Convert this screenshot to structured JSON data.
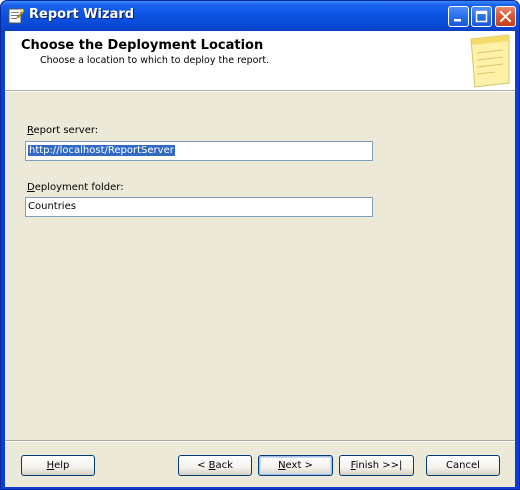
{
  "window": {
    "title": "Report Wizard",
    "title_icon": "wizard-icon"
  },
  "titlebar_buttons": {
    "minimize_icon": "minimize-icon",
    "maximize_icon": "maximize-icon",
    "close_icon": "close-icon"
  },
  "header": {
    "title": "Choose the Deployment Location",
    "subtitle": "Choose a location to which to deploy the report.",
    "icon": "notepad-icon"
  },
  "form": {
    "report_server": {
      "label_mnemonic": "R",
      "label_rest": "eport server:",
      "value": "http://localhost/ReportServer"
    },
    "deployment_folder": {
      "label_mnemonic": "D",
      "label_rest": "eployment folder:",
      "value": "Countries"
    }
  },
  "buttons": {
    "help": {
      "mnemonic": "H",
      "rest": "elp"
    },
    "back": {
      "pre": "< ",
      "mnemonic": "B",
      "rest": "ack"
    },
    "next": {
      "mnemonic": "N",
      "rest": "ext >"
    },
    "finish": {
      "mnemonic": "F",
      "rest": "inish >>|"
    },
    "cancel": {
      "label": "Cancel"
    }
  },
  "colors": {
    "titlebar": "#0a4ad6",
    "dialog_bg": "#ece9d8",
    "selection": "#316ac5"
  }
}
